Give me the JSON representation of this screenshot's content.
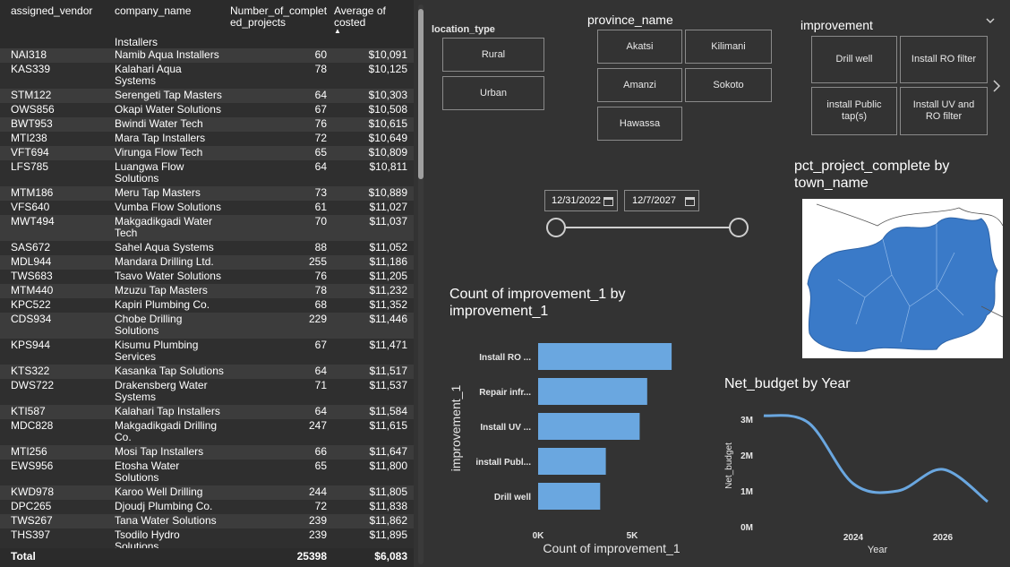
{
  "table": {
    "headers": [
      "assigned_vendor",
      "company_name",
      "Number_of_completed_projects",
      "Average of costed"
    ],
    "header_lines": {
      "assigned_vendor": [
        "assigned_vendor"
      ],
      "company_name": [
        "company_name"
      ],
      "projects": [
        "Number_of_complet",
        "ed_projects"
      ],
      "avg": [
        "Average of costed"
      ]
    },
    "partial_row_company": "Installers",
    "rows": [
      {
        "vendor": "NAI318",
        "company": [
          "Namib Aqua Installers"
        ],
        "projects": "60",
        "avg": "$10,091"
      },
      {
        "vendor": "KAS339",
        "company": [
          "Kalahari Aqua",
          "Systems"
        ],
        "projects": "78",
        "avg": "$10,125"
      },
      {
        "vendor": "STM122",
        "company": [
          "Serengeti Tap Masters"
        ],
        "projects": "64",
        "avg": "$10,303"
      },
      {
        "vendor": "OWS856",
        "company": [
          "Okapi Water Solutions"
        ],
        "projects": "67",
        "avg": "$10,508"
      },
      {
        "vendor": "BWT953",
        "company": [
          "Bwindi Water Tech"
        ],
        "projects": "76",
        "avg": "$10,615"
      },
      {
        "vendor": "MTI238",
        "company": [
          "Mara Tap Installers"
        ],
        "projects": "72",
        "avg": "$10,649"
      },
      {
        "vendor": "VFT694",
        "company": [
          "Virunga Flow Tech"
        ],
        "projects": "65",
        "avg": "$10,809"
      },
      {
        "vendor": "LFS785",
        "company": [
          "Luangwa Flow",
          "Solutions"
        ],
        "projects": "64",
        "avg": "$10,811"
      },
      {
        "vendor": "MTM186",
        "company": [
          "Meru Tap Masters"
        ],
        "projects": "73",
        "avg": "$10,889"
      },
      {
        "vendor": "VFS640",
        "company": [
          "Vumba Flow Solutions"
        ],
        "projects": "61",
        "avg": "$11,027"
      },
      {
        "vendor": "MWT494",
        "company": [
          "Makgadikgadi Water",
          "Tech"
        ],
        "projects": "70",
        "avg": "$11,037"
      },
      {
        "vendor": "SAS672",
        "company": [
          "Sahel Aqua Systems"
        ],
        "projects": "88",
        "avg": "$11,052"
      },
      {
        "vendor": "MDL944",
        "company": [
          "Mandara Drilling Ltd."
        ],
        "projects": "255",
        "avg": "$11,186"
      },
      {
        "vendor": "TWS683",
        "company": [
          "Tsavo Water Solutions"
        ],
        "projects": "76",
        "avg": "$11,205"
      },
      {
        "vendor": "MTM440",
        "company": [
          "Mzuzu Tap Masters"
        ],
        "projects": "78",
        "avg": "$11,232"
      },
      {
        "vendor": "KPC522",
        "company": [
          "Kapiri Plumbing Co."
        ],
        "projects": "68",
        "avg": "$11,352"
      },
      {
        "vendor": "CDS934",
        "company": [
          "Chobe Drilling",
          "Solutions"
        ],
        "projects": "229",
        "avg": "$11,446"
      },
      {
        "vendor": "KPS944",
        "company": [
          "Kisumu Plumbing",
          "Services"
        ],
        "projects": "67",
        "avg": "$11,471"
      },
      {
        "vendor": "KTS322",
        "company": [
          "Kasanka Tap Solutions"
        ],
        "projects": "64",
        "avg": "$11,517"
      },
      {
        "vendor": "DWS722",
        "company": [
          "Drakensberg Water",
          "Systems"
        ],
        "projects": "71",
        "avg": "$11,537"
      },
      {
        "vendor": "KTI587",
        "company": [
          "Kalahari Tap Installers"
        ],
        "projects": "64",
        "avg": "$11,584"
      },
      {
        "vendor": "MDC828",
        "company": [
          "Makgadikgadi Drilling",
          "Co."
        ],
        "projects": "247",
        "avg": "$11,615"
      },
      {
        "vendor": "MTI256",
        "company": [
          "Mosi Tap Installers"
        ],
        "projects": "66",
        "avg": "$11,647"
      },
      {
        "vendor": "EWS956",
        "company": [
          "Etosha Water",
          "Solutions"
        ],
        "projects": "65",
        "avg": "$11,800"
      },
      {
        "vendor": "KWD978",
        "company": [
          "Karoo Well Drilling"
        ],
        "projects": "244",
        "avg": "$11,805"
      },
      {
        "vendor": "DPC265",
        "company": [
          "Djoudj Plumbing Co."
        ],
        "projects": "72",
        "avg": "$11,838"
      },
      {
        "vendor": "TWS267",
        "company": [
          "Tana Water Solutions"
        ],
        "projects": "239",
        "avg": "$11,862"
      },
      {
        "vendor": "THS397",
        "company": [
          "Tsodilo Hydro",
          "Solutions"
        ],
        "projects": "239",
        "avg": "$11,895"
      }
    ],
    "total": {
      "label": "Total",
      "projects": "25398",
      "avg": "$6,083"
    }
  },
  "location_slicer": {
    "title": "location_type",
    "options": [
      "Rural",
      "Urban"
    ]
  },
  "province_slicer": {
    "title": "province_name",
    "options": [
      "Akatsi",
      "Kilimani",
      "Amanzi",
      "Sokoto",
      "Hawassa"
    ]
  },
  "improvement_slicer": {
    "title": "improvement",
    "options": [
      "Drill well",
      "Install RO filter",
      "install Public tap(s)",
      "Install UV and RO filter"
    ]
  },
  "date_slicer": {
    "start": "12/31/2022",
    "end": "12/7/2027"
  },
  "map": {
    "title_lines": [
      "pct_project_complete by",
      "town_name"
    ],
    "fill_color": "#3a7ac8"
  },
  "bar_chart": {
    "title_lines": [
      "Count of improvement_1 by",
      "improvement_1"
    ],
    "chart_data": {
      "type": "bar",
      "orientation": "horizontal",
      "categories": [
        "Install RO ...",
        "Repair infr...",
        "Install UV ...",
        "install Publ...",
        "Drill well"
      ],
      "values": [
        7100,
        5800,
        5400,
        3600,
        3300
      ],
      "xlabel": "Count of improvement_1",
      "ylabel": "improvement_1",
      "xticks": [
        "0K",
        "5K"
      ],
      "xlim": [
        0,
        10000
      ],
      "color": "#6aa7e0"
    }
  },
  "line_chart": {
    "title": "Net_budget by Year",
    "chart_data": {
      "type": "line",
      "x": [
        2022,
        2023,
        2024,
        2025,
        2026,
        2027
      ],
      "values": [
        3100000,
        2900000,
        1200000,
        1000000,
        1600000,
        700000
      ],
      "xlabel": "Year",
      "ylabel": "Net_budget",
      "yticks": [
        "3M",
        "2M",
        "1M",
        "0M"
      ],
      "xticks": [
        "2024",
        "2026"
      ],
      "ylim": [
        0,
        3000000
      ],
      "color": "#6aa7e0"
    }
  }
}
